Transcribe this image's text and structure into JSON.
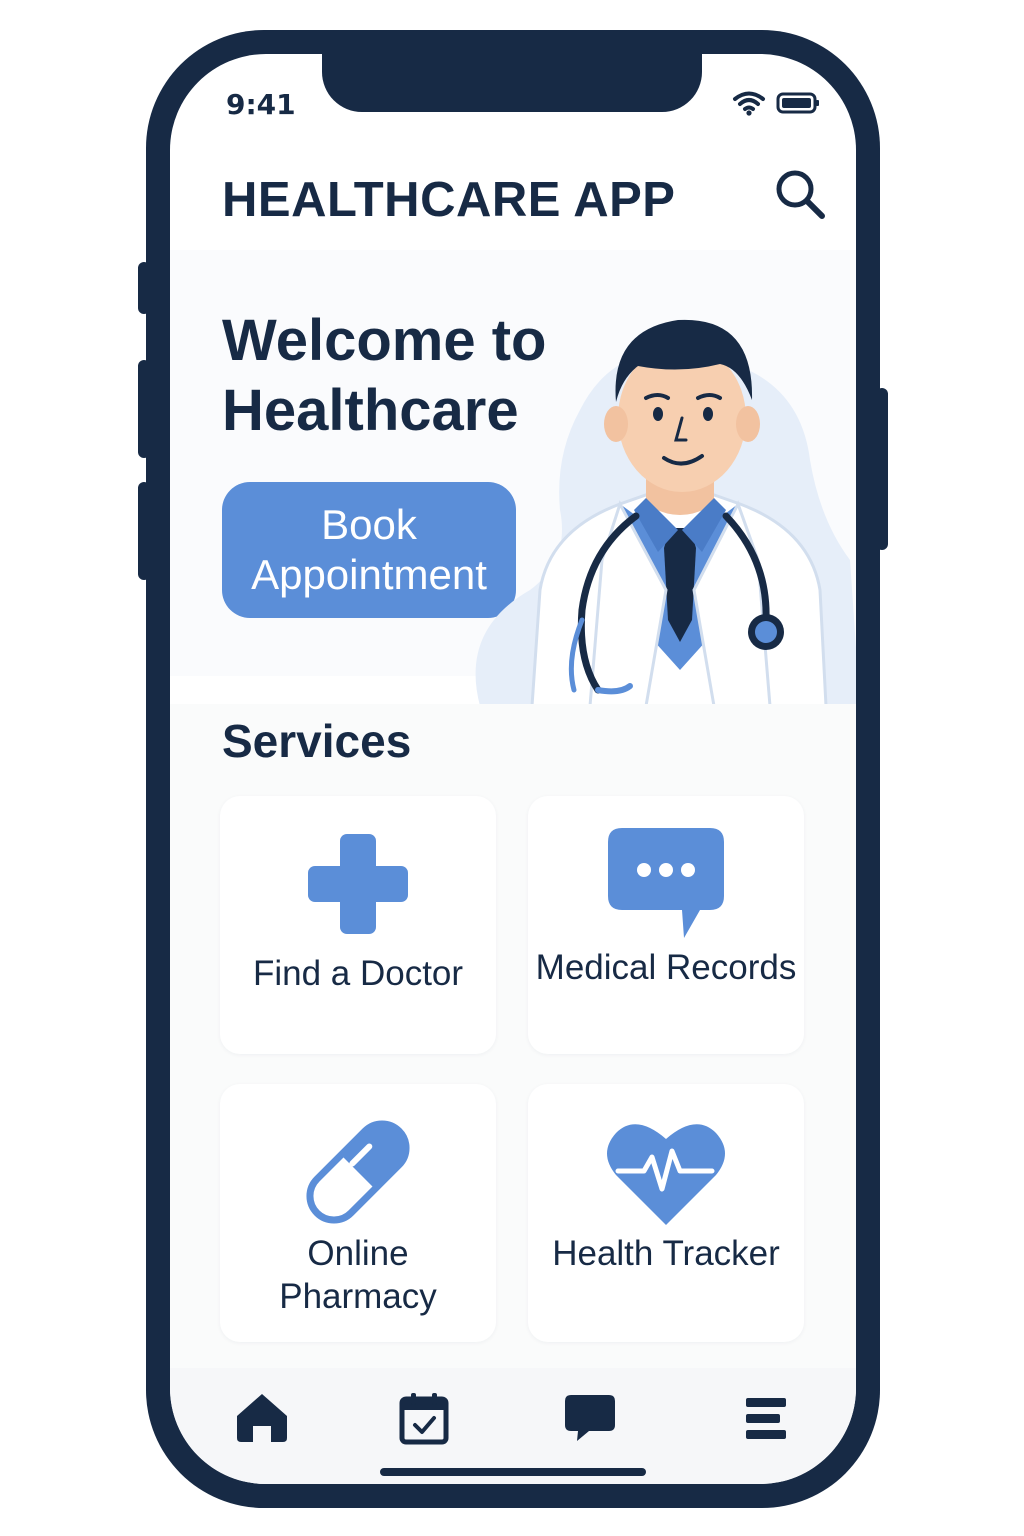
{
  "status_bar": {
    "time": "9:41",
    "icons": [
      "wifi-icon",
      "battery-icon"
    ]
  },
  "header": {
    "title": "HEALTHCARE APP",
    "search_icon": "search-icon"
  },
  "hero": {
    "title": "Welcome to Healthcare",
    "button_label": "Book Appointment",
    "illustration": "doctor-illustration"
  },
  "services": {
    "title": "Services",
    "items": [
      {
        "label": "Find a Doctor",
        "icon": "plus-cross-icon"
      },
      {
        "label": "Medical Records",
        "icon": "chat-bubble-icon"
      },
      {
        "label": "Online Pharmacy",
        "icon": "pill-icon"
      },
      {
        "label": "Health Tracker",
        "icon": "heart-pulse-icon"
      }
    ]
  },
  "bottom_nav": {
    "items": [
      {
        "icon": "home-icon"
      },
      {
        "icon": "calendar-check-icon"
      },
      {
        "icon": "chat-icon"
      },
      {
        "icon": "menu-icon"
      }
    ]
  },
  "colors": {
    "primary": "#5b8ed8",
    "dark": "#172a45",
    "background": "#ffffff",
    "surface": "#fafbfb"
  }
}
